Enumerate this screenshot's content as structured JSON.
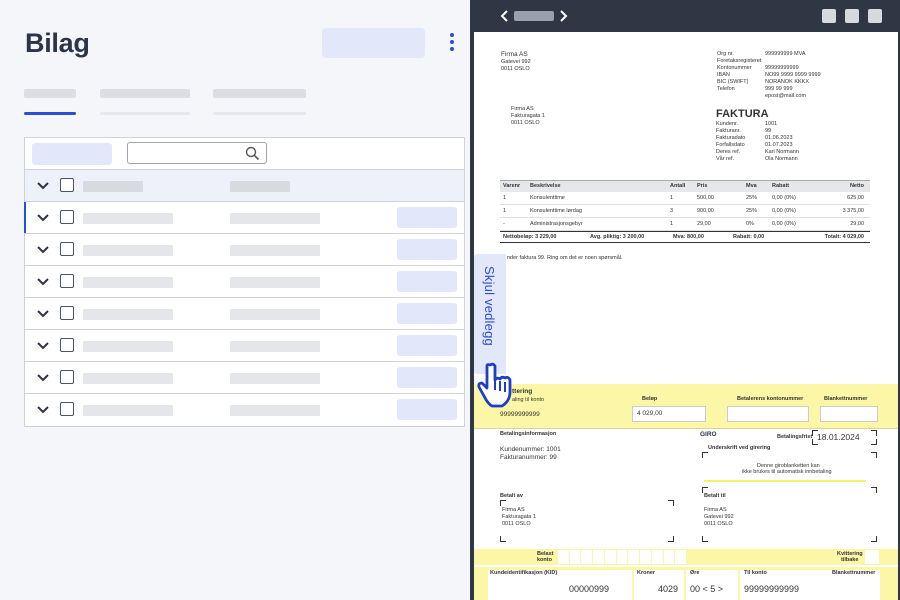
{
  "page": {
    "title": "Bilag"
  },
  "left_panel": {
    "tabs": [
      {
        "label": ""
      },
      {
        "label": ""
      },
      {
        "label": ""
      }
    ],
    "rows": 8
  },
  "viewer": {
    "hide_attachment_label": "Skjul vedlegg"
  },
  "invoice": {
    "sender_name": "Firma AS",
    "sender_addr1": "Gatevei 992",
    "sender_addr2": "0011 OSLO",
    "company_info": {
      "org_label": "Org nr.",
      "org_value": "999999999 MVA",
      "reg_label": "Foretaksregisteret",
      "account_label": "Kontonummer",
      "account_value": "99999999999",
      "iban_label": "IBAN",
      "iban_value": "NO99 9999 9999 9999",
      "bic_label": "BIC (SWIFT)",
      "bic_value": "NORANOK KKKX",
      "phone_label": "Telefon",
      "phone_value": "999 99 999",
      "email_value": "epost@mail.com"
    },
    "recipient_name": "Firma AS",
    "recipient_addr1": "Fakturagata 1",
    "recipient_addr2": "0011 OSLO",
    "title": "FAKTURA",
    "meta": [
      {
        "label": "Kundenr.",
        "value": "1001"
      },
      {
        "label": "Fakturanr.",
        "value": "99"
      },
      {
        "label": "Fakturadato",
        "value": "01.06.2023"
      },
      {
        "label": "Forfallsdato",
        "value": "01.07.2023"
      },
      {
        "label": "Deres ref.",
        "value": "Kari Normann"
      },
      {
        "label": "Vår ref.",
        "value": "Ola Normann"
      }
    ],
    "columns": [
      "Varenr",
      "Beskrivelse",
      "Antall",
      "Pris",
      "Mva",
      "Rabatt",
      "Netto"
    ],
    "lines": [
      {
        "nr": "1",
        "desc": "Konsulenttime",
        "qty": "1",
        "price": "500,00",
        "vat": "25%",
        "disc": "0,00 (0%)",
        "net": "625,00"
      },
      {
        "nr": "1",
        "desc": "Konsulenttime lørdag",
        "qty": "3",
        "price": "900,00",
        "vat": "25%",
        "disc": "0,00 (0%)",
        "net": "3 375,00"
      },
      {
        "nr": "-",
        "desc": "Administrasjonsgebyr",
        "qty": "1",
        "price": "29,00",
        "vat": "0%",
        "disc": "0,00 (0%)",
        "net": "29,00"
      }
    ],
    "totals": {
      "net": "Nettobeløp: 3 229,00",
      "due": "Avg. pliktig: 3 200,00",
      "vat": "Mva: 800,00",
      "disc": "Rabatt: 0,00",
      "total": "Totalt: 4 029,00"
    },
    "note": "nder faktura 99. Ring om det er noen spørsmål."
  },
  "giro": {
    "heading": "ttering",
    "to_account_label": "aling til konto",
    "to_account_value": "99999999999",
    "amount_label": "Beløp",
    "amount_value": "4 029,00",
    "payer_account_label": "Betalerens kontonummer",
    "form_label": "Blankettnummer",
    "info_label": "Betalingsinformasjon",
    "customer_no": "Kundenummer: 1001",
    "invoice_no": "Fakturanummer: 99",
    "giro_title": "GIRO",
    "due_label": "Betalingsfrist",
    "due_value": "18.01.2024",
    "signature_label": "Underskrift ved girering",
    "warning1": "Denne giroblanketten kan",
    "warning2": "ikke brukes til automatisk innbetaling",
    "paid_by_label": "Betalt av",
    "paid_by_name": "Firma AS",
    "paid_by_addr1": "Fakturagata 1",
    "paid_by_addr2": "0011 OSLO",
    "paid_to_label": "Betalt til",
    "paid_to_name": "Firma AS",
    "paid_to_addr1": "Gatevei 992",
    "paid_to_addr2": "0011 OSLO",
    "debited_label1": "Belast",
    "debited_label2": "konto",
    "receipt_label1": "Kvittering",
    "receipt_label2": "tilbake",
    "kid_label": "Kundeidentifikasjon (KID)",
    "kroner_label": "Kroner",
    "ore_label": "Øre",
    "to_account_label2": "Til konto",
    "form_no_label": "Blankettnummer",
    "kid_value": "00000999",
    "kroner_value": "4029",
    "ore_value": "00 < 5 >",
    "account_value_bottom": "99999999999"
  }
}
